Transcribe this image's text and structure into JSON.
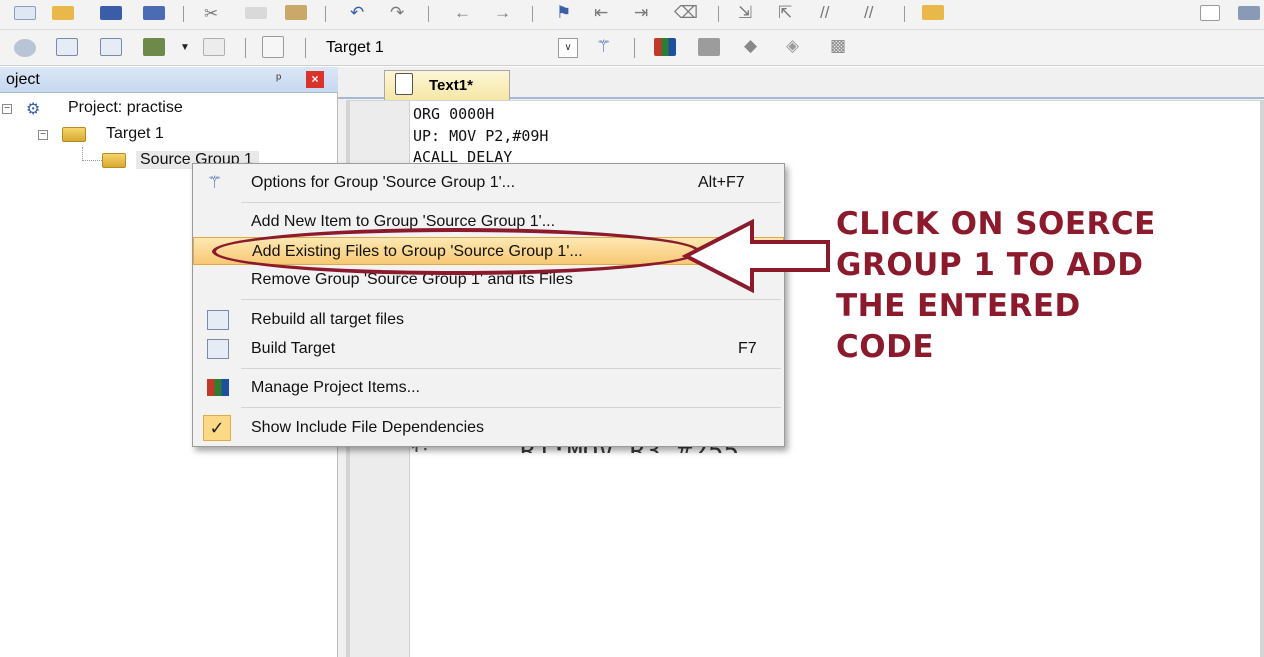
{
  "toolbar": {
    "target_label": "Target 1"
  },
  "project_pane": {
    "title": "oject",
    "pin_glyph": "ᵖ",
    "close_glyph": "×",
    "tree": {
      "project_label": "Project: practise",
      "target_label": "Target 1",
      "group_label": "Source Group 1"
    }
  },
  "editor": {
    "tab_label": "Text1*",
    "code_lines": [
      "ORG 0000H",
      "UP: MOV P2,#09H",
      "ACALL DELAY"
    ],
    "obscured_fragment": "R1:MOV R3,#255"
  },
  "context_menu": {
    "items": [
      {
        "label": "Options for Group 'Source Group 1'...",
        "shortcut": "Alt+F7",
        "icon": "wand-icon"
      },
      {
        "label": "Add New  Item to Group 'Source Group 1'...",
        "shortcut": "",
        "icon": ""
      },
      {
        "label": "Add Existing Files to Group 'Source Group 1'...",
        "shortcut": "",
        "icon": "",
        "highlighted": true
      },
      {
        "label": "Remove Group 'Source Group 1' and its Files",
        "shortcut": "",
        "icon": ""
      },
      {
        "label": "Rebuild all target files",
        "shortcut": "",
        "icon": "rebuild-icon"
      },
      {
        "label": "Build Target",
        "shortcut": "F7",
        "icon": "build-icon"
      },
      {
        "label": "Manage Project Items...",
        "shortcut": "",
        "icon": "manage-items-icon"
      },
      {
        "label": "Show Include File Dependencies",
        "shortcut": "",
        "icon": "check-icon",
        "checked": true
      }
    ]
  },
  "annotation": {
    "lines": [
      "CLICK ON SOERCE",
      "GROUP 1 TO ADD",
      "THE ENTERED",
      "CODE"
    ],
    "color": "#8b1a2d"
  },
  "colors": {
    "highlight": "#f7c873",
    "pane_header": "#c6d8ef",
    "tab": "#f6e7a6"
  }
}
